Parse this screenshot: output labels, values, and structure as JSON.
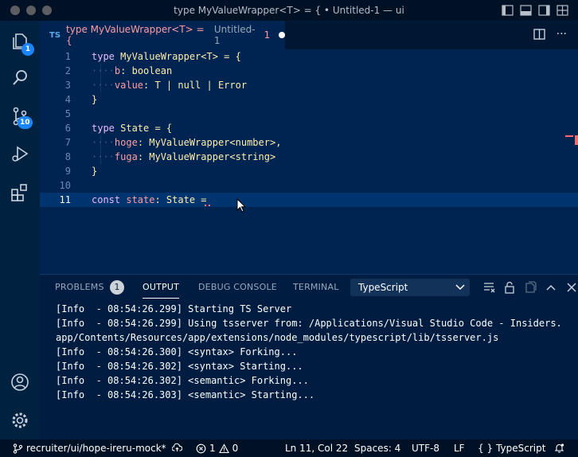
{
  "window": {
    "title": "type MyValueWrapper<T> = { • Untitled-1 — ui"
  },
  "activity_bar": {
    "explorer_badge": "1",
    "scm_badge": "10"
  },
  "tab": {
    "lang": "TS",
    "name": "type MyValueWrapper<T> = {",
    "description": "Untitled-1",
    "problem_count": "1"
  },
  "editor": {
    "line_numbers": [
      "1",
      "2",
      "3",
      "4",
      "5",
      "6",
      "7",
      "8",
      "9",
      "10",
      "11"
    ],
    "lines": [
      [
        {
          "t": "type",
          "c": "kw"
        },
        {
          "t": " MyValueWrapper<T> = {",
          "c": "ty"
        }
      ],
      [
        {
          "t": "····",
          "c": "ws"
        },
        {
          "t": "b",
          "c": "prop"
        },
        {
          "t": ": boolean",
          "c": "ty"
        }
      ],
      [
        {
          "t": "····",
          "c": "ws"
        },
        {
          "t": "value",
          "c": "prop"
        },
        {
          "t": ": T | null | Error",
          "c": "ty"
        }
      ],
      [
        {
          "t": "}",
          "c": "ty"
        }
      ],
      [],
      [
        {
          "t": "type",
          "c": "kw"
        },
        {
          "t": " State = {",
          "c": "ty"
        }
      ],
      [
        {
          "t": "····",
          "c": "ws"
        },
        {
          "t": "hoge",
          "c": "prop"
        },
        {
          "t": ": MyValueWrapper<number>,",
          "c": "ty"
        }
      ],
      [
        {
          "t": "····",
          "c": "ws"
        },
        {
          "t": "fuga",
          "c": "prop"
        },
        {
          "t": ": MyValueWrapper<string>",
          "c": "ty"
        }
      ],
      [
        {
          "t": "}",
          "c": "ty"
        }
      ],
      [],
      [
        {
          "t": "const",
          "c": "kw"
        },
        {
          "t": " state",
          "c": "prop"
        },
        {
          "t": ": State =",
          "c": "ty"
        }
      ]
    ],
    "active_line": 11
  },
  "panel": {
    "tabs": {
      "problems": "PROBLEMS",
      "problems_badge": "1",
      "output": "OUTPUT",
      "debug_console": "DEBUG CONSOLE",
      "terminal": "TERMINAL"
    },
    "output_channel": "TypeScript",
    "output_lines": [
      "[Info  - 08:54:26.299] Starting TS Server",
      "[Info  - 08:54:26.299] Using tsserver from: /Applications/Visual Studio Code - Insiders.",
      "app/Contents/Resources/app/extensions/node_modules/typescript/lib/tsserver.js",
      "[Info  - 08:54:26.300] <syntax> Forking...",
      "[Info  - 08:54:26.302] <syntax> Starting...",
      "[Info  - 08:54:26.302] <semantic> Forking...",
      "[Info  - 08:54:26.303] <semantic> Starting..."
    ]
  },
  "status_bar": {
    "branch": "recruiter/ui/hope-ireru-mock*",
    "errors": "1",
    "warnings": "0",
    "position": "Ln 11, Col 22",
    "spaces": "Spaces: 4",
    "encoding": "UTF-8",
    "eol": "LF",
    "language_braces": "{ }",
    "language": "TypeScript"
  },
  "colors": {
    "editor_bg": "#002451",
    "keyword": "#ebbbff",
    "type": "#ffeead",
    "property": "#ff9da4",
    "badge": "#1a85ff"
  }
}
